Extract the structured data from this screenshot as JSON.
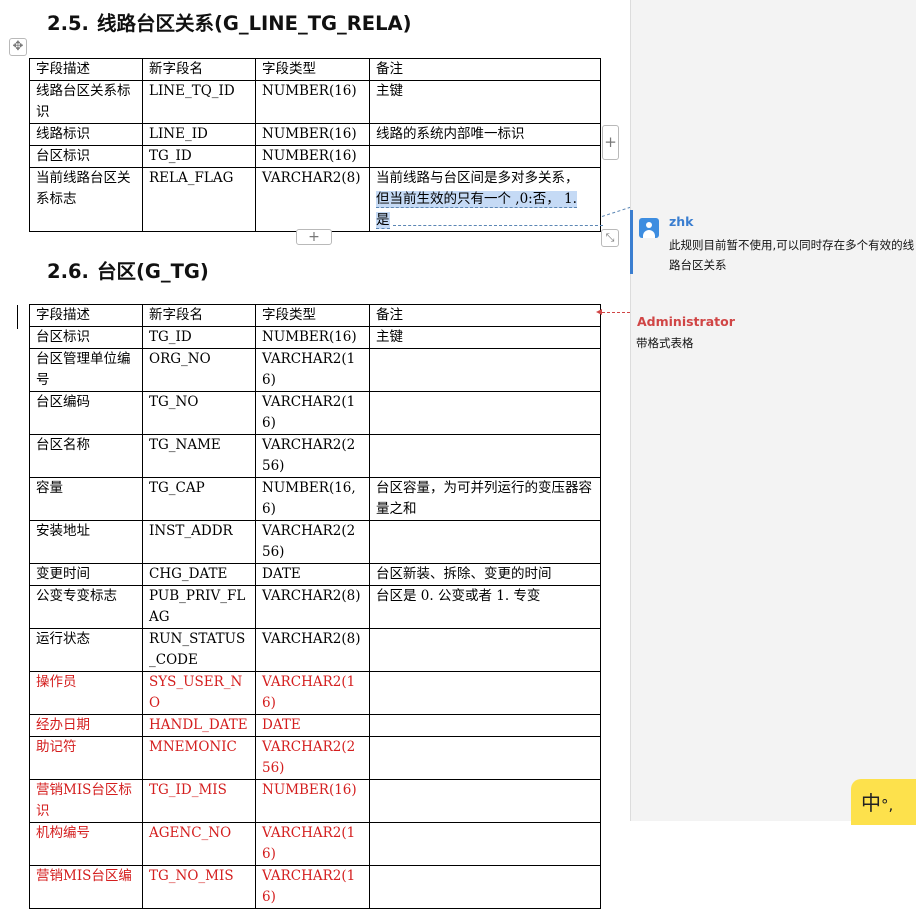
{
  "section1": {
    "number": "2.5.",
    "title": "线路台区关系(G_LINE_TG_RELA)",
    "columns": [
      "字段描述",
      "新字段名",
      "字段类型",
      "备注"
    ],
    "rows": [
      [
        "线路台区关系标识",
        "LINE_TQ_ID",
        "NUMBER(16)",
        "主键"
      ],
      [
        "线路标识",
        "LINE_ID",
        "NUMBER(16)",
        "线路的系统内部唯一标识"
      ],
      [
        "台区标识",
        "TG_ID",
        "NUMBER(16)",
        ""
      ],
      [
        "当前线路台区关系标志",
        "RELA_FLAG",
        "VARCHAR2(8)",
        ""
      ]
    ],
    "remark_last_line1": "当前线路与台区间是多对多关系，",
    "remark_last_sel1": "但当前生效的只有一个",
    "remark_last_sel2": " ,0:否， 1.",
    "remark_last_sel3": "是"
  },
  "section2": {
    "number": "2.6.",
    "title": "台区(G_TG)",
    "columns": [
      "字段描述",
      "新字段名",
      "字段类型",
      "备注"
    ],
    "rows": [
      {
        "cells": [
          "台区标识",
          "TG_ID",
          "NUMBER(16)",
          "主键"
        ],
        "red": false
      },
      {
        "cells": [
          "台区管理单位编号",
          "ORG_NO",
          "VARCHAR2(16)",
          ""
        ],
        "red": false
      },
      {
        "cells": [
          "台区编码",
          "TG_NO",
          "VARCHAR2(16)",
          ""
        ],
        "red": false
      },
      {
        "cells": [
          "台区名称",
          "TG_NAME",
          "VARCHAR2(256)",
          ""
        ],
        "red": false
      },
      {
        "cells": [
          "容量",
          "TG_CAP",
          "NUMBER(16,6)",
          "台区容量，为可并列运行的变压器容量之和"
        ],
        "red": false
      },
      {
        "cells": [
          "安装地址",
          "INST_ADDR",
          "VARCHAR2(256)",
          ""
        ],
        "red": false
      },
      {
        "cells": [
          "变更时间",
          "CHG_DATE",
          "DATE",
          "台区新装、拆除、变更的时间"
        ],
        "red": false
      },
      {
        "cells": [
          "公变专变标志",
          "PUB_PRIV_FLAG",
          "VARCHAR2(8)",
          "台区是 0. 公变或者 1. 专变"
        ],
        "red": false
      },
      {
        "cells": [
          "运行状态",
          "RUN_STATUS_CODE",
          "VARCHAR2(8)",
          ""
        ],
        "red": false
      },
      {
        "cells": [
          "操作员",
          "SYS_USER_NO",
          "VARCHAR2(16)",
          ""
        ],
        "red": true
      },
      {
        "cells": [
          "经办日期",
          "HANDL_DATE",
          "DATE",
          ""
        ],
        "red": true
      },
      {
        "cells": [
          "助记符",
          "MNEMONIC",
          "VARCHAR2(256)",
          ""
        ],
        "red": true
      },
      {
        "cells": [
          "营销MIS台区标识",
          "TG_ID_MIS",
          "NUMBER(16)",
          ""
        ],
        "red": true
      },
      {
        "cells": [
          "机构编号",
          "AGENC_NO",
          "VARCHAR2(16)",
          ""
        ],
        "red": true
      },
      {
        "cells": [
          "营销MIS台区编",
          "TG_NO_MIS",
          "VARCHAR2(16)",
          ""
        ],
        "red": true
      }
    ]
  },
  "comments": [
    {
      "author": "zhk",
      "text_line1": "此规则目前暂不使用,可以同时存在多个有效的线",
      "text_line2": "路台区关系",
      "color": "#3a7ed0"
    },
    {
      "author": "Administrator",
      "text": "带格式表格",
      "color": "#d04545"
    }
  ],
  "controls": {
    "move_icon": "✥",
    "add_col_icon": "+",
    "add_row_icon": "+",
    "resize_icon": "⤡"
  },
  "ime": {
    "label": "中",
    "extra": "°,"
  }
}
